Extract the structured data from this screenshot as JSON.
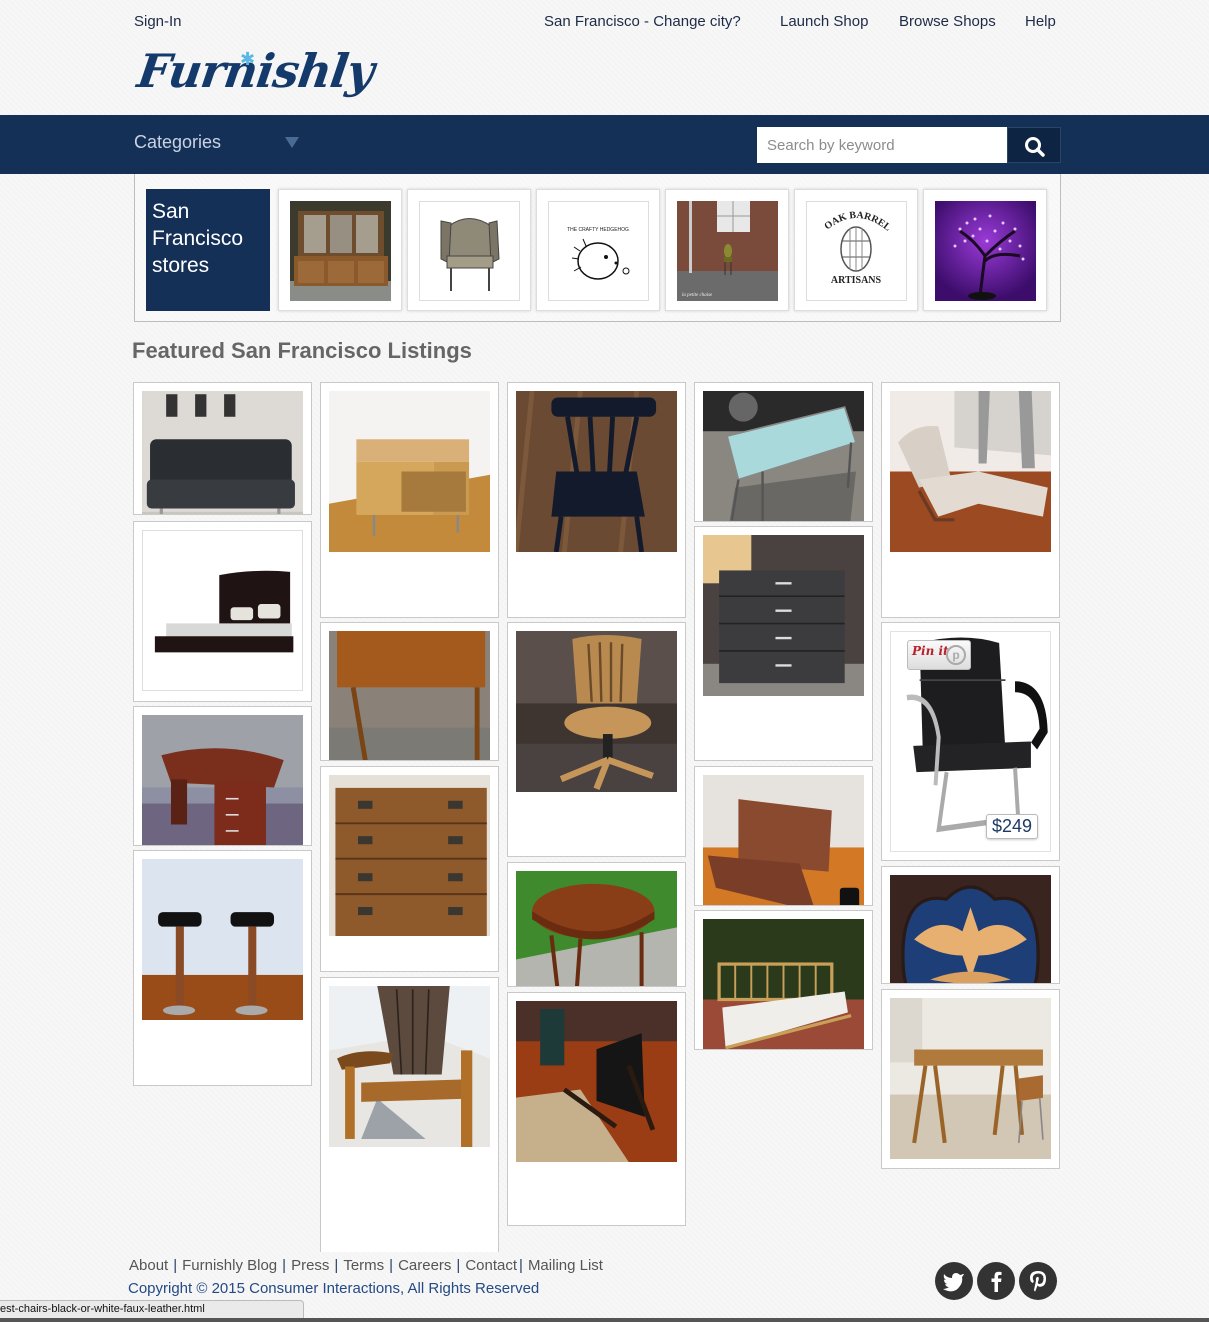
{
  "top_nav": {
    "sign_in": "Sign-In",
    "city": "San Francisco - Change city?",
    "launch_shop": "Launch Shop",
    "browse_shops": "Browse Shops",
    "help": "Help"
  },
  "logo": {
    "text": "Furnishly",
    "accent_color": "#5ab8e5",
    "color": "#143a6b"
  },
  "navbar": {
    "categories_label": "Categories",
    "search_placeholder": "Search by keyword",
    "search_value": "",
    "background": "#143057"
  },
  "stores": {
    "title": "San Francisco stores",
    "items": [
      {
        "name": "hutch-cabinet-store",
        "thumb": "wood hutch cabinet"
      },
      {
        "name": "wingback-chair-store",
        "thumb": "wingback chair sketch"
      },
      {
        "name": "crafty-hedgehog-store",
        "thumb": "THE CRAFTY HEDGEHOG"
      },
      {
        "name": "la-petite-chaise-store",
        "thumb": "la petite chaise"
      },
      {
        "name": "oak-barrel-artisans-store",
        "thumb": "OAK BARREL ARTISANS"
      },
      {
        "name": "purple-tree-lamp-store",
        "thumb": "purple blossom tree lamp"
      }
    ]
  },
  "featured": {
    "title": "Featured San Francisco Listings",
    "listings": [
      {
        "name": "black-tufted-futon"
      },
      {
        "name": "platform-bed"
      },
      {
        "name": "cherry-executive-desk"
      },
      {
        "name": "black-bar-stools"
      },
      {
        "name": "maple-nightstand"
      },
      {
        "name": "wood-work-table"
      },
      {
        "name": "campaign-chest"
      },
      {
        "name": "barrel-adirondack-chair"
      },
      {
        "name": "black-spindle-chair"
      },
      {
        "name": "oak-swivel-office-chair"
      },
      {
        "name": "round-teak-dining-table"
      },
      {
        "name": "leather-sling-chair"
      },
      {
        "name": "glass-coffee-table"
      },
      {
        "name": "black-dresser"
      },
      {
        "name": "brown-futon-sofa"
      },
      {
        "name": "bamboo-daybed"
      },
      {
        "name": "beige-recliner"
      },
      {
        "name": "black-leather-guest-chair",
        "price": "$249",
        "pin_label": "Pin it"
      },
      {
        "name": "carved-eagle-plaque"
      },
      {
        "name": "trestle-writing-desk"
      }
    ]
  },
  "footer": {
    "links": [
      "About",
      "Furnishly Blog",
      "Press",
      "Terms",
      "Careers",
      "Contact",
      "Mailing List"
    ],
    "separator": "|",
    "copyright": "Copyright © 2015 Consumer Interactions, All Rights Reserved",
    "social": [
      "twitter",
      "facebook",
      "pinterest"
    ]
  },
  "status_bar": {
    "url_text": "est-chairs-black-or-white-faux-leather.html"
  }
}
